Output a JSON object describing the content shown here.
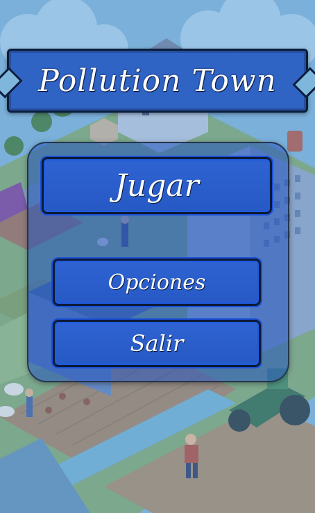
{
  "game": {
    "title": "Pollution Town"
  },
  "menu": {
    "play_label": "Jugar",
    "options_label": "Opciones",
    "exit_label": "Salir"
  }
}
